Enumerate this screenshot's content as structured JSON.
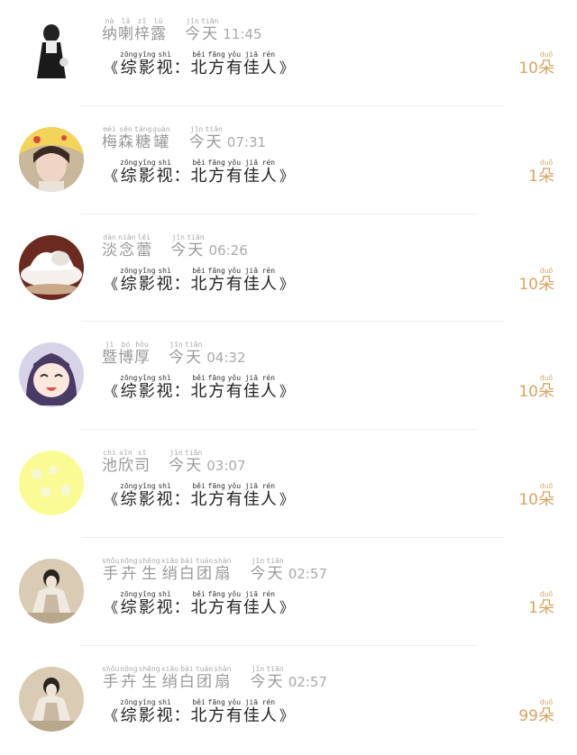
{
  "day_label": {
    "py": "jīn tiān",
    "chars": [
      "今",
      "天"
    ],
    "py_each": [
      "jīn",
      "tiān"
    ]
  },
  "gift_name": {
    "open": "《",
    "close": "》",
    "chars": [
      "综",
      "影",
      "视",
      "：",
      "北",
      "方",
      "有",
      "佳",
      "人"
    ],
    "py": [
      "zōng",
      "yǐng",
      "shì",
      "",
      "běi",
      "fāng",
      "yǒu",
      "jiā",
      "rén"
    ]
  },
  "unit": {
    "char": "朵",
    "py": "duǒ"
  },
  "items": [
    {
      "name": [
        "纳",
        "喇",
        "梓",
        "露"
      ],
      "name_py": [
        "nà",
        "lǎ",
        "zǐ",
        "lù"
      ],
      "time": "11:45",
      "count": "10",
      "avatar": "girl-figure-icon"
    },
    {
      "name": [
        "梅",
        "森",
        "糖",
        "罐"
      ],
      "name_py": [
        "méi",
        "sēn",
        "táng",
        "guàn"
      ],
      "time": "07:31",
      "count": "1",
      "avatar": "girl-photo-icon"
    },
    {
      "name": [
        "淡",
        "念",
        "蕾"
      ],
      "name_py": [
        "dàn",
        "niàn",
        "lěi"
      ],
      "time": "06:26",
      "count": "10",
      "avatar": "cake-icon"
    },
    {
      "name": [
        "暨",
        "博",
        "厚"
      ],
      "name_py": [
        "jì",
        "bó",
        "hòu"
      ],
      "time": "04:32",
      "count": "10",
      "avatar": "anime-girl-icon"
    },
    {
      "name": [
        "池",
        "欣",
        "司"
      ],
      "name_py": [
        "chí",
        "xīn",
        "sī"
      ],
      "time": "03:07",
      "count": "10",
      "avatar": "yellow-circle-icon"
    },
    {
      "name": [
        "手",
        "卉",
        "生",
        "绡",
        "白",
        "团",
        "扇"
      ],
      "name_py": [
        "shǒu",
        "nōng",
        "shēng",
        "xiāo",
        "bái",
        "tuán",
        "shàn"
      ],
      "time": "02:57",
      "count": "1",
      "avatar": "ancient-lady-icon"
    },
    {
      "name": [
        "手",
        "卉",
        "生",
        "绡",
        "白",
        "团",
        "扇"
      ],
      "name_py": [
        "shǒu",
        "nōng",
        "shēng",
        "xiāo",
        "bái",
        "tuán",
        "shàn"
      ],
      "time": "02:57",
      "count": "99",
      "avatar": "ancient-lady-icon"
    }
  ]
}
